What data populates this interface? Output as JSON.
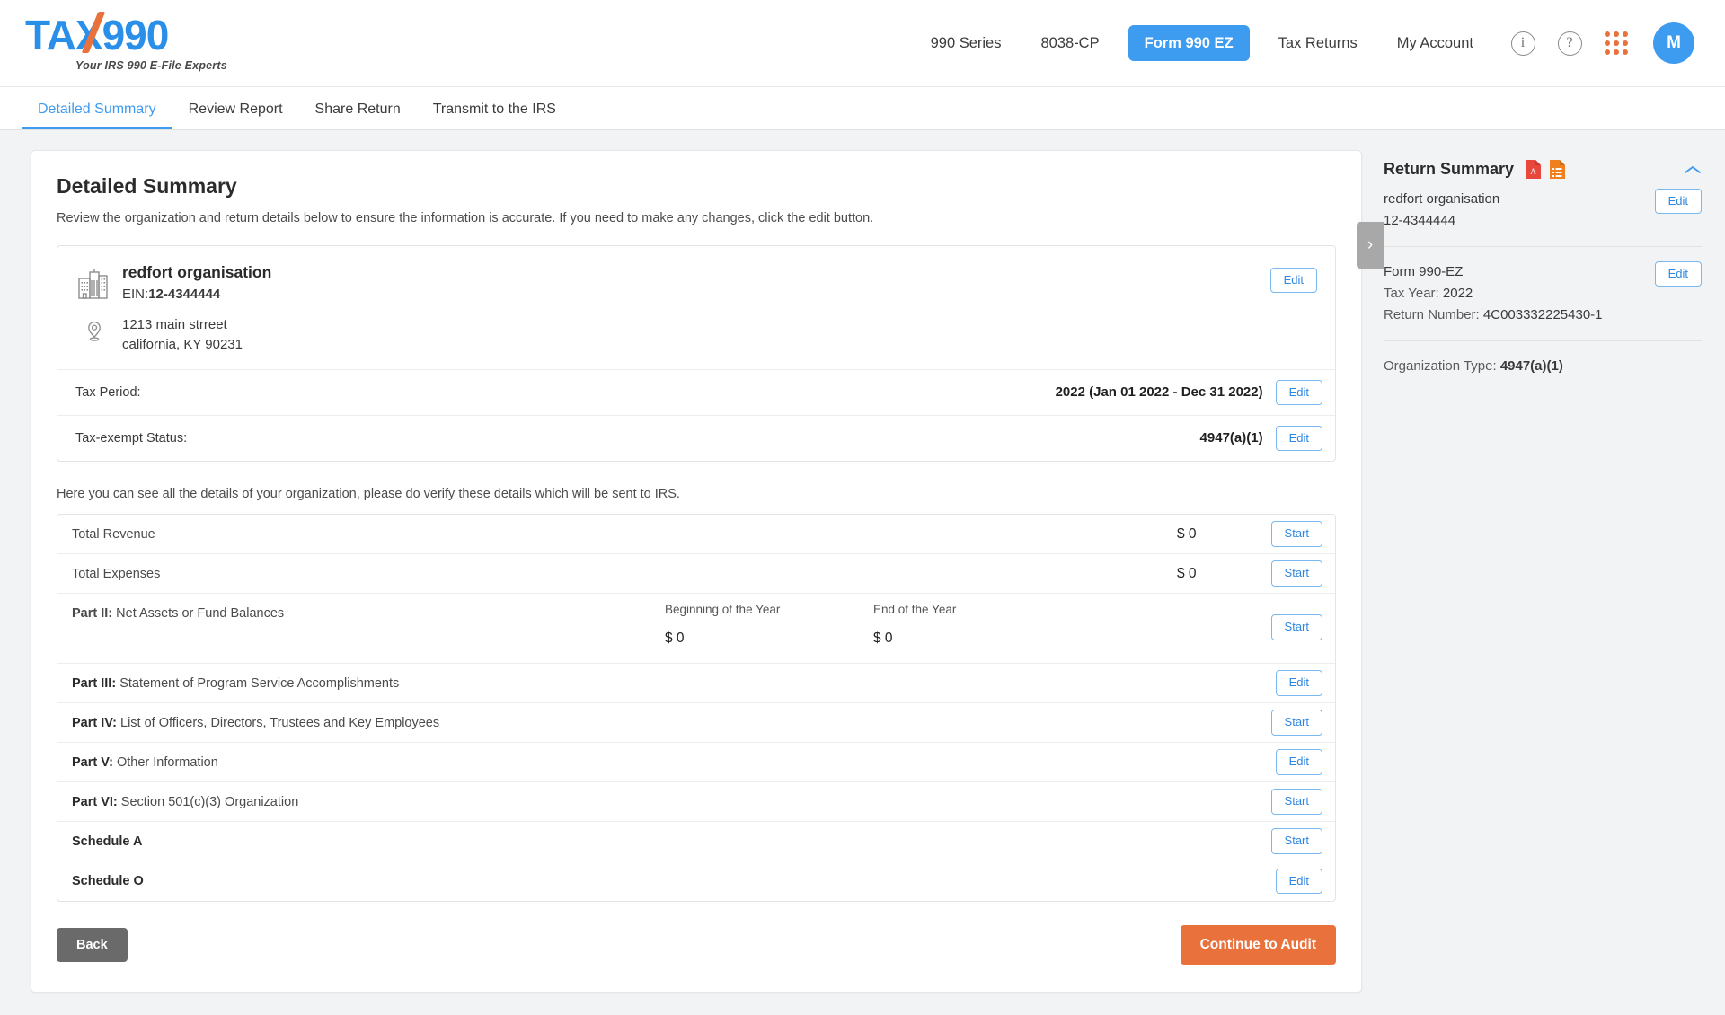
{
  "brand": {
    "name": "TAX990",
    "name_part1": "TA",
    "name_part2": "X990",
    "tagline": "Your IRS 990 E-File Experts",
    "logo_blue": "#2a8fe8",
    "logo_orange": "#e8713c"
  },
  "nav": {
    "links": [
      {
        "label": "990 Series",
        "active": false
      },
      {
        "label": "8038-CP",
        "active": false
      },
      {
        "label": "Form 990 EZ",
        "active": true
      },
      {
        "label": "Tax Returns",
        "active": false
      },
      {
        "label": "My Account",
        "active": false
      }
    ],
    "info_icon": "info-icon",
    "info_glyph": "i",
    "help_icon": "help-icon",
    "help_glyph": "?",
    "apps_icon": "apps-grid-icon",
    "avatar_initial": "M",
    "accent_blue": "#3d9bf0",
    "accent_orange": "#e8713c"
  },
  "tabs": [
    {
      "label": "Detailed Summary",
      "active": true
    },
    {
      "label": "Review Report",
      "active": false
    },
    {
      "label": "Share Return",
      "active": false
    },
    {
      "label": "Transmit to the IRS",
      "active": false
    }
  ],
  "main": {
    "title": "Detailed Summary",
    "subtitle": "Review the organization and return details below to ensure the information is accurate. If you need to make any changes, click the edit button.",
    "org": {
      "name": "redfort organisation",
      "ein_label": "EIN:",
      "ein": "12-4344444",
      "address_line1": "1213 main strreet",
      "address_line2": "california, KY 90231",
      "edit_label": "Edit",
      "rows": [
        {
          "label": "Tax Period:",
          "value": "2022 (Jan 01 2022 - Dec 31 2022)",
          "button": "Edit"
        },
        {
          "label": "Tax-exempt Status:",
          "value": "4947(a)(1)",
          "button": "Edit"
        }
      ]
    },
    "mid_note": "Here you can see all the details of your organization, please do verify these details which will be sent to IRS.",
    "detail_rows": [
      {
        "bold": "",
        "label": "Total Revenue",
        "amount": "$ 0",
        "button": "Start"
      },
      {
        "bold": "",
        "label": "Total Expenses",
        "amount": "$ 0",
        "button": "Start"
      },
      {
        "bold": "Part III:",
        "label": "Statement of Program Service Accomplishments",
        "amount": "",
        "button": "Edit"
      },
      {
        "bold": "Part IV:",
        "label": "List of Officers, Directors, Trustees and Key Employees",
        "amount": "",
        "button": "Start"
      },
      {
        "bold": "Part V:",
        "label": "Other Information",
        "amount": "",
        "button": "Edit"
      },
      {
        "bold": "Part VI:",
        "label": "Section 501(c)(3) Organization",
        "amount": "",
        "button": "Start"
      },
      {
        "bold": "Schedule A",
        "label": "",
        "amount": "",
        "button": "Start"
      },
      {
        "bold": "Schedule O",
        "label": "",
        "amount": "",
        "button": "Edit"
      }
    ],
    "part2": {
      "bold": "Part II:",
      "label": "Net Assets or Fund Balances",
      "col1_head": "Beginning of the Year",
      "col1_value": "$ 0",
      "col2_head": "End of the Year",
      "col2_value": "$ 0",
      "button": "Start"
    },
    "footer": {
      "back_label": "Back",
      "continue_label": "Continue to Audit"
    }
  },
  "sidebar": {
    "title": "Return Summary",
    "pdf_icon": "pdf-file-icon",
    "list_icon": "list-file-icon",
    "collapse_icon": "chevron-up-icon",
    "expand_icon": "chevron-right-icon",
    "org_name": "redfort organisation",
    "ein": "12-4344444",
    "edit_label": "Edit",
    "form_name": "Form 990-EZ",
    "tax_year_label": "Tax Year:",
    "tax_year": "2022",
    "return_number_label": "Return Number:",
    "return_number": "4C003332225430-1",
    "org_type_label": "Organization Type:",
    "org_type": "4947(a)(1)"
  }
}
